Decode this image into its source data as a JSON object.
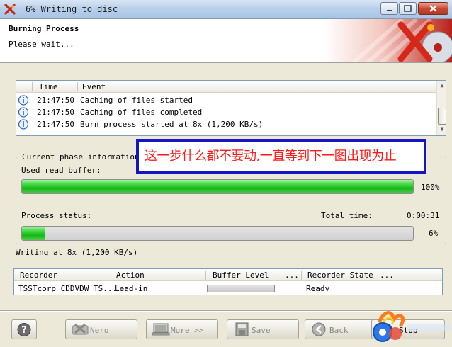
{
  "window": {
    "title": "6% Writing to disc"
  },
  "header": {
    "title": "Burning Process",
    "subtitle": "Please wait..."
  },
  "event_log": {
    "columns": [
      "Time",
      "Event"
    ],
    "rows": [
      {
        "icon": "info-icon",
        "time": "21:47:50",
        "event": "Caching of files started"
      },
      {
        "icon": "info-icon",
        "time": "21:47:50",
        "event": "Caching of files completed"
      },
      {
        "icon": "info-icon",
        "time": "21:47:50",
        "event": "Burn process started at 8x (1,200 KB/s)"
      }
    ]
  },
  "phase": {
    "group_label": "Current phase information",
    "read_buffer_label": "Used read buffer:",
    "read_buffer_percent": 100,
    "read_buffer_text": "100%",
    "process_status_label": "Process status:",
    "total_time_label": "Total time:",
    "total_time_value": "0:00:31",
    "process_percent": 6,
    "process_text": "6%"
  },
  "annotation": {
    "text": "这一步什么都不要动,一直等到下一图出现为止"
  },
  "writing_at": "Writing at 8x (1,200 KB/s)",
  "recorder_table": {
    "columns": [
      {
        "label": "Recorder"
      },
      {
        "label": "Action"
      },
      {
        "label": "Buffer Level",
        "more": "..."
      },
      {
        "label": "Recorder State",
        "more": "..."
      }
    ],
    "row": {
      "recorder": "TSSTcorp CDDVDW TS...",
      "action": "Lead-in",
      "buffer_level_percent": 0,
      "state": "Ready"
    }
  },
  "buttons": {
    "nero": "Nero",
    "more": "More >>",
    "save": "Save",
    "back": "Back",
    "stop": "Stop"
  },
  "colors": {
    "progress_green": "#16b816",
    "annotation_text": "#ff1a1a",
    "annotation_border": "#1414c8"
  }
}
